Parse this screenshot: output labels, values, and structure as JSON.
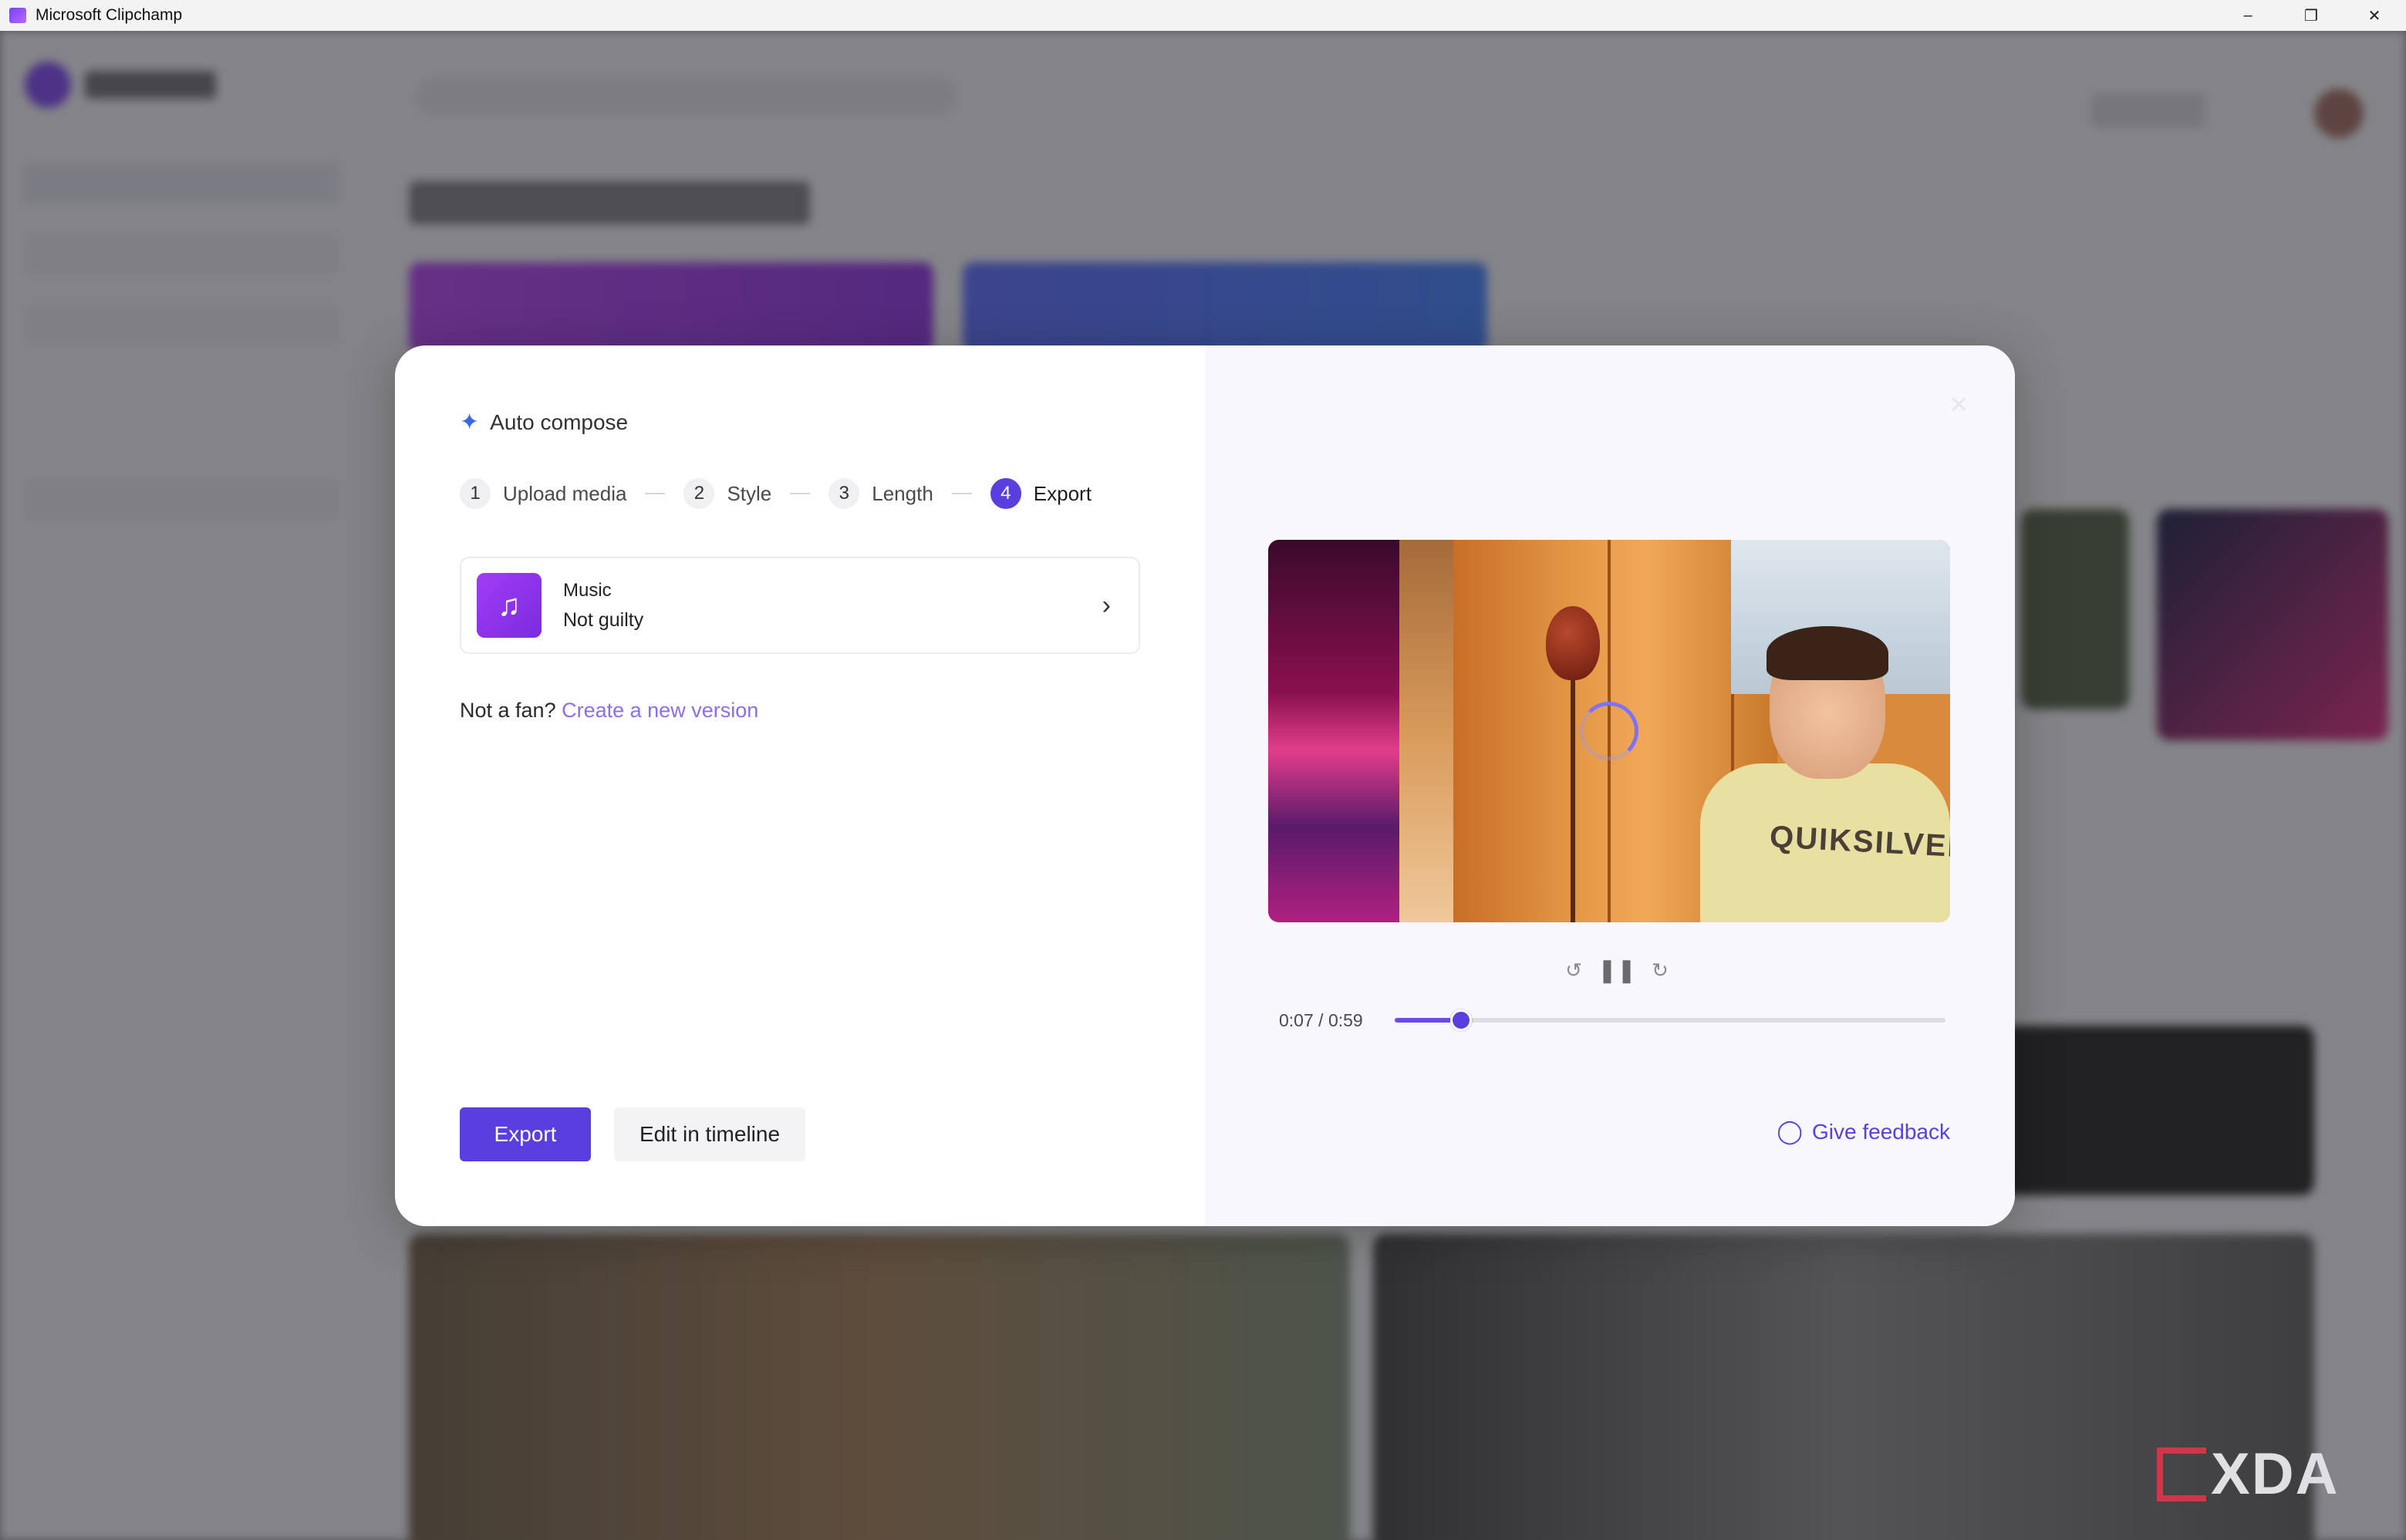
{
  "window": {
    "title": "Microsoft Clipchamp",
    "controls": [
      "minimize-icon",
      "restore-icon",
      "close-icon"
    ]
  },
  "modal": {
    "header": {
      "icon": "sparkle-icon",
      "title": "Auto compose"
    },
    "steps": [
      {
        "number": "1",
        "label": "Upload media",
        "active": false
      },
      {
        "number": "2",
        "label": "Style",
        "active": false
      },
      {
        "number": "3",
        "label": "Length",
        "active": false
      },
      {
        "number": "4",
        "label": "Export",
        "active": true
      }
    ],
    "music_card": {
      "icon": "music-note-icon",
      "title": "Music",
      "subtitle": "Not guilty"
    },
    "not_a_fan": {
      "prefix": "Not a fan?",
      "link": "Create a new version"
    },
    "buttons": {
      "export": "Export",
      "edit_in_timeline": "Edit in timeline"
    },
    "player": {
      "shirt_text": "QUIKSILVER",
      "current_time": "0:07",
      "separator": "/",
      "duration": "0:59",
      "progress": 0.12,
      "controls": [
        "rewind-5-icon",
        "pause-icon",
        "forward-5-icon"
      ]
    },
    "feedback": {
      "icon": "lightbulb-icon",
      "label": "Give feedback"
    }
  },
  "watermark": {
    "text": "XDA"
  },
  "colors": {
    "accent": "#5b3ee0",
    "link": "#8d6cf0",
    "music_gradient_start": "#a23cf5",
    "music_gradient_end": "#7a2ce0",
    "xda_red": "#d2344a"
  }
}
